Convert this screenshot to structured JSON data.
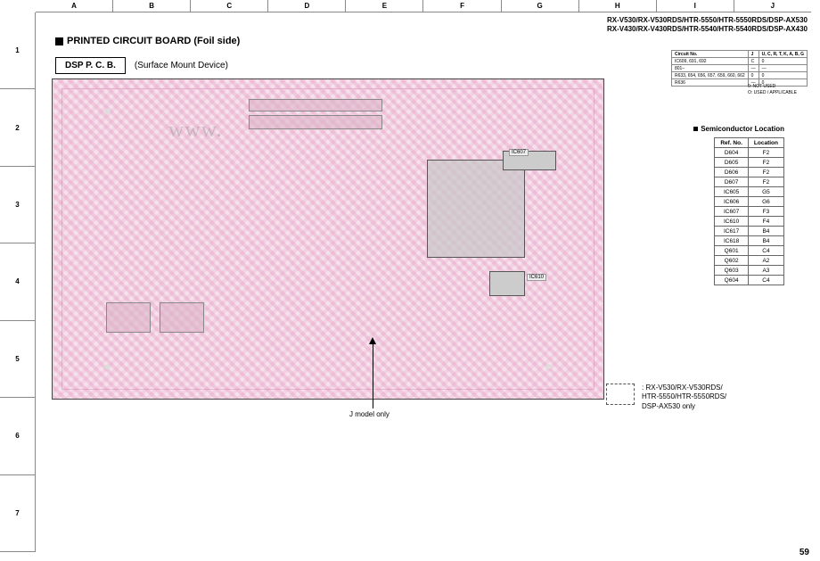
{
  "ruler_cols": [
    "A",
    "B",
    "C",
    "D",
    "E",
    "F",
    "G",
    "H",
    "I",
    "J"
  ],
  "ruler_rows": [
    "1",
    "2",
    "3",
    "4",
    "5",
    "6",
    "7"
  ],
  "header": {
    "line1": "RX-V530/RX-V530RDS/HTR-5550/HTR-5550RDS/DSP-AX530",
    "line2": "RX-V430/RX-V430RDS/HTR-5540/HTR-5540RDS/DSP-AX430"
  },
  "section_title": "PRINTED CIRCUIT BOARD (Foil side)",
  "board_box": "DSP P. C. B.",
  "board_subtitle": "(Surface Mount Device)",
  "watermark": "www.",
  "arrow_note": "J model only",
  "dashed_note_prefix": ": ",
  "dashed_note_l1": "RX-V530/RX-V530RDS/",
  "dashed_note_l2": "HTR-5550/HTR-5550RDS/",
  "dashed_note_l3": "DSP-AX530 only",
  "circuit_table": {
    "header": [
      "Circuit No.",
      "J",
      "U, C, R, T, K, A, B, G"
    ],
    "rows": [
      [
        "IC609, 691, 692",
        "C",
        "0"
      ],
      [
        "801–",
        "—",
        "—"
      ],
      [
        "R633, 654, 656, 657, 659, 660, 662",
        "0",
        "0"
      ],
      [
        "R636",
        "—",
        "0"
      ]
    ]
  },
  "circuit_notes_l1": "0: NOT USED",
  "circuit_notes_l2": "O: USED / APPLICABLE",
  "semi_heading": "Semiconductor Location",
  "semi_table": {
    "header": [
      "Ref. No.",
      "Location"
    ],
    "rows": [
      [
        "D604",
        "F2"
      ],
      [
        "D605",
        "F2"
      ],
      [
        "D606",
        "F2"
      ],
      [
        "D607",
        "F2"
      ],
      [
        "IC605",
        "G5"
      ],
      [
        "IC606",
        "G6"
      ],
      [
        "IC607",
        "F3"
      ],
      [
        "IC610",
        "F4"
      ],
      [
        "IC617",
        "B4"
      ],
      [
        "IC618",
        "B4"
      ],
      [
        "Q601",
        "C4"
      ],
      [
        "Q602",
        "A2"
      ],
      [
        "Q603",
        "A3"
      ],
      [
        "Q604",
        "C4"
      ]
    ]
  },
  "chip_labels": {
    "ic607": "IC607",
    "ic610": "IC610"
  },
  "page_number": "59"
}
